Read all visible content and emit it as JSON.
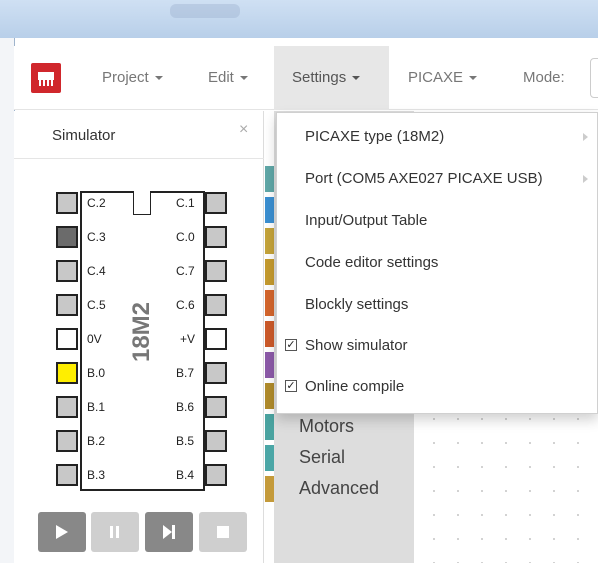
{
  "nav": {
    "project": "Project",
    "edit": "Edit",
    "settings": "Settings",
    "picaxe": "PICAXE",
    "mode": "Mode:"
  },
  "simulator": {
    "title": "Simulator",
    "close": "×",
    "chip_name": "18M2",
    "left_pins": [
      "C.2",
      "C.3",
      "C.4",
      "C.5",
      "0V",
      "B.0",
      "B.1",
      "B.2",
      "B.3"
    ],
    "right_pins": [
      "C.1",
      "C.0",
      "C.7",
      "C.6",
      "+V",
      "B.7",
      "B.6",
      "B.5",
      "B.4"
    ],
    "left_pin_states": [
      "grey",
      "dark",
      "grey",
      "grey",
      "white",
      "yellow",
      "grey",
      "grey",
      "grey"
    ],
    "right_pin_states": [
      "grey",
      "grey",
      "grey",
      "grey",
      "white",
      "grey",
      "grey",
      "grey",
      "grey"
    ],
    "controls": [
      {
        "name": "run-icon",
        "enabled": true
      },
      {
        "name": "pause-icon",
        "enabled": false
      },
      {
        "name": "step-icon",
        "enabled": true
      },
      {
        "name": "stop-icon",
        "enabled": false
      }
    ]
  },
  "categories": [
    "Motors",
    "Serial",
    "Advanced"
  ],
  "strip_colors": [
    "#5fa7a7",
    "#3b8fd1",
    "#c4a33a",
    "#c49a2e",
    "#d4652c",
    "#cc5a2a",
    "#8c5aa8",
    "#b08b2b",
    "#4aa3a0",
    "#4ba6a6",
    "#c49a3a"
  ],
  "settings_menu": {
    "items": [
      {
        "label": "PICAXE type (18M2)",
        "submenu": true
      },
      {
        "label": "Port (COM5 AXE027 PICAXE USB)",
        "submenu": true
      },
      {
        "label": "Input/Output Table"
      },
      {
        "label": "Code editor settings"
      },
      {
        "label": "Blockly settings"
      },
      {
        "label": "Show simulator",
        "checked": true
      },
      {
        "label": "Online compile",
        "checked": true
      }
    ]
  },
  "colors": {
    "brand_red": "#d0272c",
    "highlight_pin": "#ffee00"
  }
}
